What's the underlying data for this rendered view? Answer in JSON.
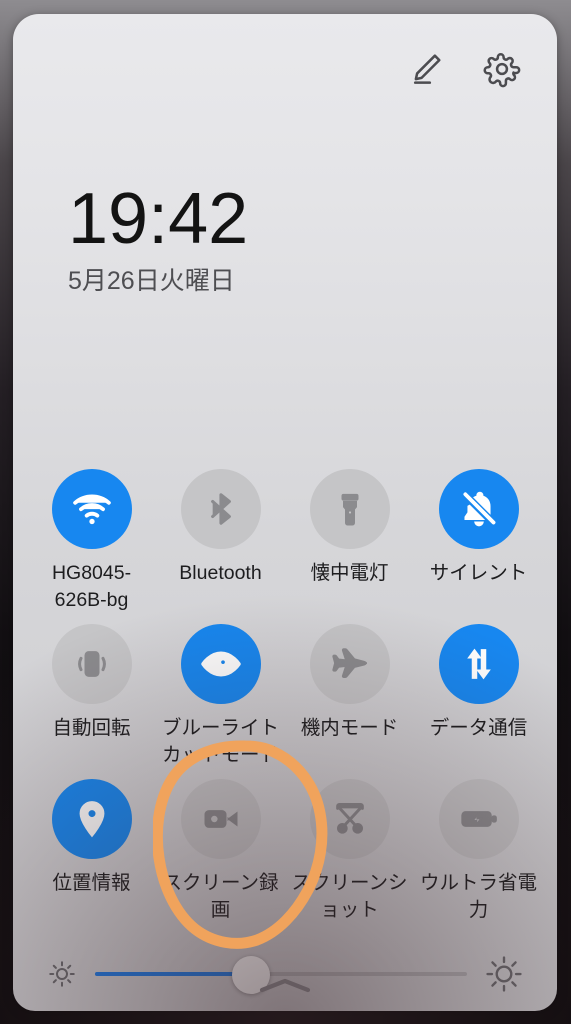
{
  "status_panel": {
    "header": {
      "edit_icon": "pencil-edit-icon",
      "settings_icon": "gear-icon"
    },
    "clock": {
      "time": "19:42",
      "date": "5月26日火曜日"
    },
    "colors": {
      "toggle_on": "#1787f0",
      "toggle_off": "#c5c5c7",
      "toggle_off_glyph": "#8b8b8e",
      "panel_bg_top": "#e9e9ec",
      "panel_bg_bottom": "#cfcfd2",
      "annotation": "#f0a35c",
      "slider_fill": "#1a7ae8",
      "slider_rail": "#b3b3b6"
    },
    "toggles": [
      {
        "label": "HG8045-626B-bg",
        "icon": "wifi-icon",
        "state": "on"
      },
      {
        "label": "Bluetooth",
        "icon": "bluetooth-icon",
        "state": "off"
      },
      {
        "label": "懐中電灯",
        "icon": "flashlight-icon",
        "state": "off"
      },
      {
        "label": "サイレント",
        "icon": "bell-off-icon",
        "state": "on"
      },
      {
        "label": "自動回転",
        "icon": "auto-rotate-icon",
        "state": "off"
      },
      {
        "label": "ブルーライトカットモード",
        "icon": "eye-icon",
        "state": "on"
      },
      {
        "label": "機内モード",
        "icon": "airplane-icon",
        "state": "off"
      },
      {
        "label": "データ通信",
        "icon": "data-transfer-icon",
        "state": "on"
      },
      {
        "label": "位置情報",
        "icon": "location-pin-icon",
        "state": "on"
      },
      {
        "label": "スクリーン録画",
        "icon": "video-camera-icon",
        "state": "off"
      },
      {
        "label": "スクリーンショット",
        "icon": "scissors-icon",
        "state": "off"
      },
      {
        "label": "ウルトラ省電力",
        "icon": "battery-bolt-icon",
        "state": "off"
      }
    ],
    "brightness": {
      "left_icon": "sun-low-icon",
      "right_icon": "sun-high-icon",
      "value_percent": 42
    },
    "collapse_handle": "chevron-up-icon",
    "annotation": {
      "shape": "hand-drawn-ellipse",
      "target_label": "スクリーン録画"
    }
  }
}
